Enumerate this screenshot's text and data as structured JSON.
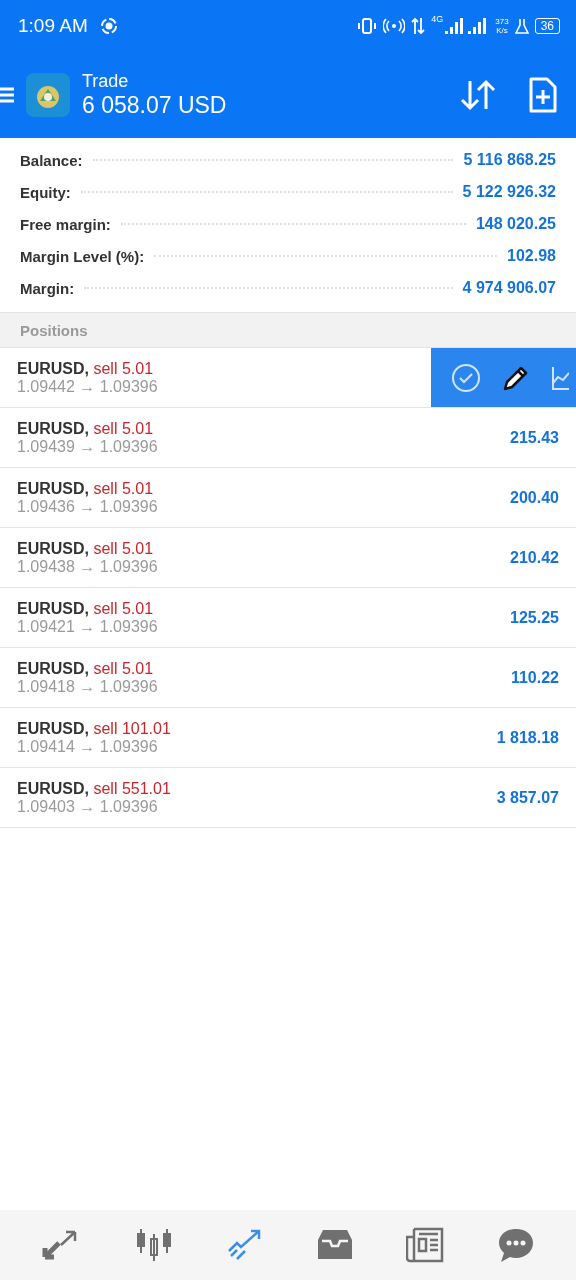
{
  "status_bar": {
    "time": "1:09 AM",
    "network": "4G",
    "speed": "373",
    "speed_unit": "K/s",
    "battery": "36"
  },
  "header": {
    "title": "Trade",
    "balance": "6 058.07 USD"
  },
  "account": [
    {
      "label": "Balance:",
      "value": "5 116 868.25"
    },
    {
      "label": "Equity:",
      "value": "5 122 926.32"
    },
    {
      "label": "Free margin:",
      "value": "148 020.25"
    },
    {
      "label": "Margin Level (%):",
      "value": "102.98"
    },
    {
      "label": "Margin:",
      "value": "4 974 906.07"
    }
  ],
  "positions_header": "Positions",
  "positions": [
    {
      "symbol": "EURUSD,",
      "side": "sell 5.01",
      "open": "1.09442",
      "arrow": "→",
      "current": "1.09396",
      "swiped": true
    },
    {
      "symbol": "EURUSD,",
      "side": "sell 5.01",
      "open": "1.09439",
      "arrow": "→",
      "current": "1.09396",
      "profit": "215.43",
      "swiped": false
    },
    {
      "symbol": "EURUSD,",
      "side": "sell 5.01",
      "open": "1.09436",
      "arrow": "→",
      "current": "1.09396",
      "profit": "200.40",
      "swiped": false
    },
    {
      "symbol": "EURUSD,",
      "side": "sell 5.01",
      "open": "1.09438",
      "arrow": "→",
      "current": "1.09396",
      "profit": "210.42",
      "swiped": false
    },
    {
      "symbol": "EURUSD,",
      "side": "sell 5.01",
      "open": "1.09421",
      "arrow": "→",
      "current": "1.09396",
      "profit": "125.25",
      "swiped": false
    },
    {
      "symbol": "EURUSD,",
      "side": "sell 5.01",
      "open": "1.09418",
      "arrow": "→",
      "current": "1.09396",
      "profit": "110.22",
      "swiped": false
    },
    {
      "symbol": "EURUSD,",
      "side": "sell 101.01",
      "open": "1.09414",
      "arrow": "→",
      "current": "1.09396",
      "profit": "1 818.18",
      "swiped": false
    },
    {
      "symbol": "EURUSD,",
      "side": "sell 551.01",
      "open": "1.09403",
      "arrow": "→",
      "current": "1.09396",
      "profit": "3 857.07",
      "swiped": false
    }
  ],
  "nav": [
    {
      "kind": "quotes",
      "selected": false
    },
    {
      "kind": "chart",
      "selected": false
    },
    {
      "kind": "trade",
      "selected": true
    },
    {
      "kind": "history",
      "selected": false
    },
    {
      "kind": "news",
      "selected": false
    },
    {
      "kind": "chat",
      "selected": false
    }
  ]
}
